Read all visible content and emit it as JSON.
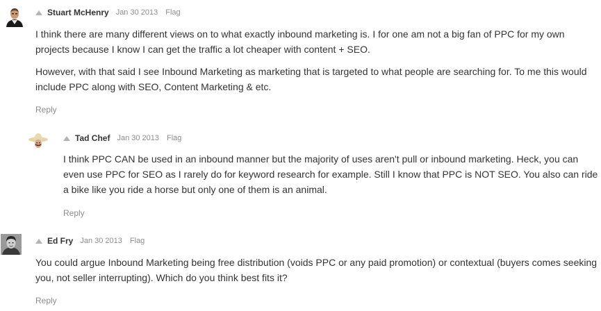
{
  "comments": [
    {
      "author": "Stuart McHenry",
      "date": "Jan 30 2013",
      "flag": "Flag",
      "paragraphs": [
        "I think there are many different views on to what exactly inbound marketing is.  I for one am not a big fan of PPC for my own projects because I know I can get the traffic a lot cheaper with content + SEO.",
        "However, with that said I see Inbound Marketing as marketing that is targeted to what people are searching for.  To me this would include PPC along with SEO, Content Marketing & etc."
      ],
      "reply": "Reply"
    },
    {
      "author": "Tad Chef",
      "date": "Jan 30 2013",
      "flag": "Flag",
      "paragraphs": [
        "I think PPC CAN be used in an inbound manner but the majority of uses aren't pull or inbound marketing. Heck, you can even use PPC for SEO as I rarely do for keyword research for example. Still I know that PPC is NOT SEO. You also can ride a bike like you ride a horse but only one of them is an animal."
      ],
      "reply": "Reply"
    },
    {
      "author": "Ed Fry",
      "date": "Jan 30 2013",
      "flag": "Flag",
      "paragraphs": [
        "You could argue Inbound Marketing being free distribution (voids PPC or any paid promotion) or contextual (buyers comes seeking you, not seller interrupting). Which do you think best fits it?"
      ],
      "reply": "Reply"
    }
  ]
}
